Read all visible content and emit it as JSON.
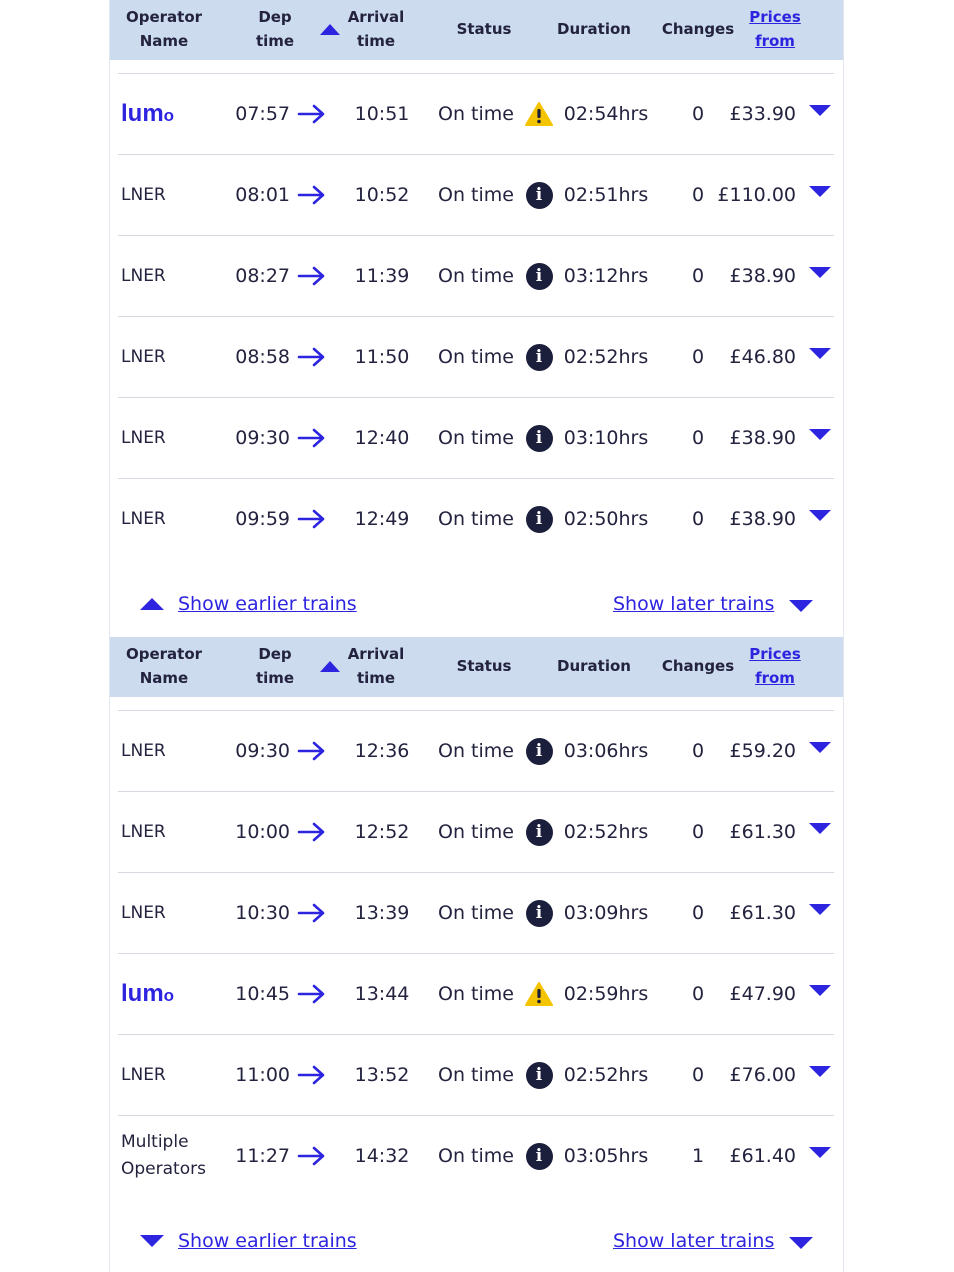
{
  "headers": {
    "operator": "Operator Name",
    "dep": "Dep time",
    "arrival": "Arrival time",
    "status": "Status",
    "duration": "Duration",
    "changes": "Changes",
    "prices": "Prices from"
  },
  "panels": [
    {
      "rows": [
        {
          "operator": "lumo",
          "dep": "07:57",
          "arr": "10:51",
          "status": "On time",
          "status_icon": "warning-icon",
          "duration": "02:54hrs",
          "changes": "0",
          "price": "£33.90"
        },
        {
          "operator": "LNER",
          "dep": "08:01",
          "arr": "10:52",
          "status": "On time",
          "status_icon": "info-icon",
          "duration": "02:51hrs",
          "changes": "0",
          "price": "£110.00"
        },
        {
          "operator": "LNER",
          "dep": "08:27",
          "arr": "11:39",
          "status": "On time",
          "status_icon": "info-icon",
          "duration": "03:12hrs",
          "changes": "0",
          "price": "£38.90"
        },
        {
          "operator": "LNER",
          "dep": "08:58",
          "arr": "11:50",
          "status": "On time",
          "status_icon": "info-icon",
          "duration": "02:52hrs",
          "changes": "0",
          "price": "£46.80"
        },
        {
          "operator": "LNER",
          "dep": "09:30",
          "arr": "12:40",
          "status": "On time",
          "status_icon": "info-icon",
          "duration": "03:10hrs",
          "changes": "0",
          "price": "£38.90"
        },
        {
          "operator": "LNER",
          "dep": "09:59",
          "arr": "12:49",
          "status": "On time",
          "status_icon": "info-icon",
          "duration": "02:50hrs",
          "changes": "0",
          "price": "£38.90"
        }
      ],
      "show_earlier": "Show earlier trains",
      "show_later": "Show later trains"
    },
    {
      "rows": [
        {
          "operator": "LNER",
          "dep": "09:30",
          "arr": "12:36",
          "status": "On time",
          "status_icon": "info-icon",
          "duration": "03:06hrs",
          "changes": "0",
          "price": "£59.20"
        },
        {
          "operator": "LNER",
          "dep": "10:00",
          "arr": "12:52",
          "status": "On time",
          "status_icon": "info-icon",
          "duration": "02:52hrs",
          "changes": "0",
          "price": "£61.30"
        },
        {
          "operator": "LNER",
          "dep": "10:30",
          "arr": "13:39",
          "status": "On time",
          "status_icon": "info-icon",
          "duration": "03:09hrs",
          "changes": "0",
          "price": "£61.30"
        },
        {
          "operator": "lumo",
          "dep": "10:45",
          "arr": "13:44",
          "status": "On time",
          "status_icon": "warning-icon",
          "duration": "02:59hrs",
          "changes": "0",
          "price": "£47.90"
        },
        {
          "operator": "LNER",
          "dep": "11:00",
          "arr": "13:52",
          "status": "On time",
          "status_icon": "info-icon",
          "duration": "02:52hrs",
          "changes": "0",
          "price": "£76.00"
        },
        {
          "operator": "Multiple Operators",
          "dep": "11:27",
          "arr": "14:32",
          "status": "On time",
          "status_icon": "info-icon",
          "duration": "03:05hrs",
          "changes": "1",
          "price": "£61.40"
        }
      ],
      "show_earlier": "Show earlier trains",
      "show_later": "Show later trains"
    }
  ],
  "colors": {
    "accent": "#2d24e0",
    "header_bg": "#ccdbee",
    "info_icon": "#1b1f3b",
    "warning_icon": "#f5c400"
  }
}
